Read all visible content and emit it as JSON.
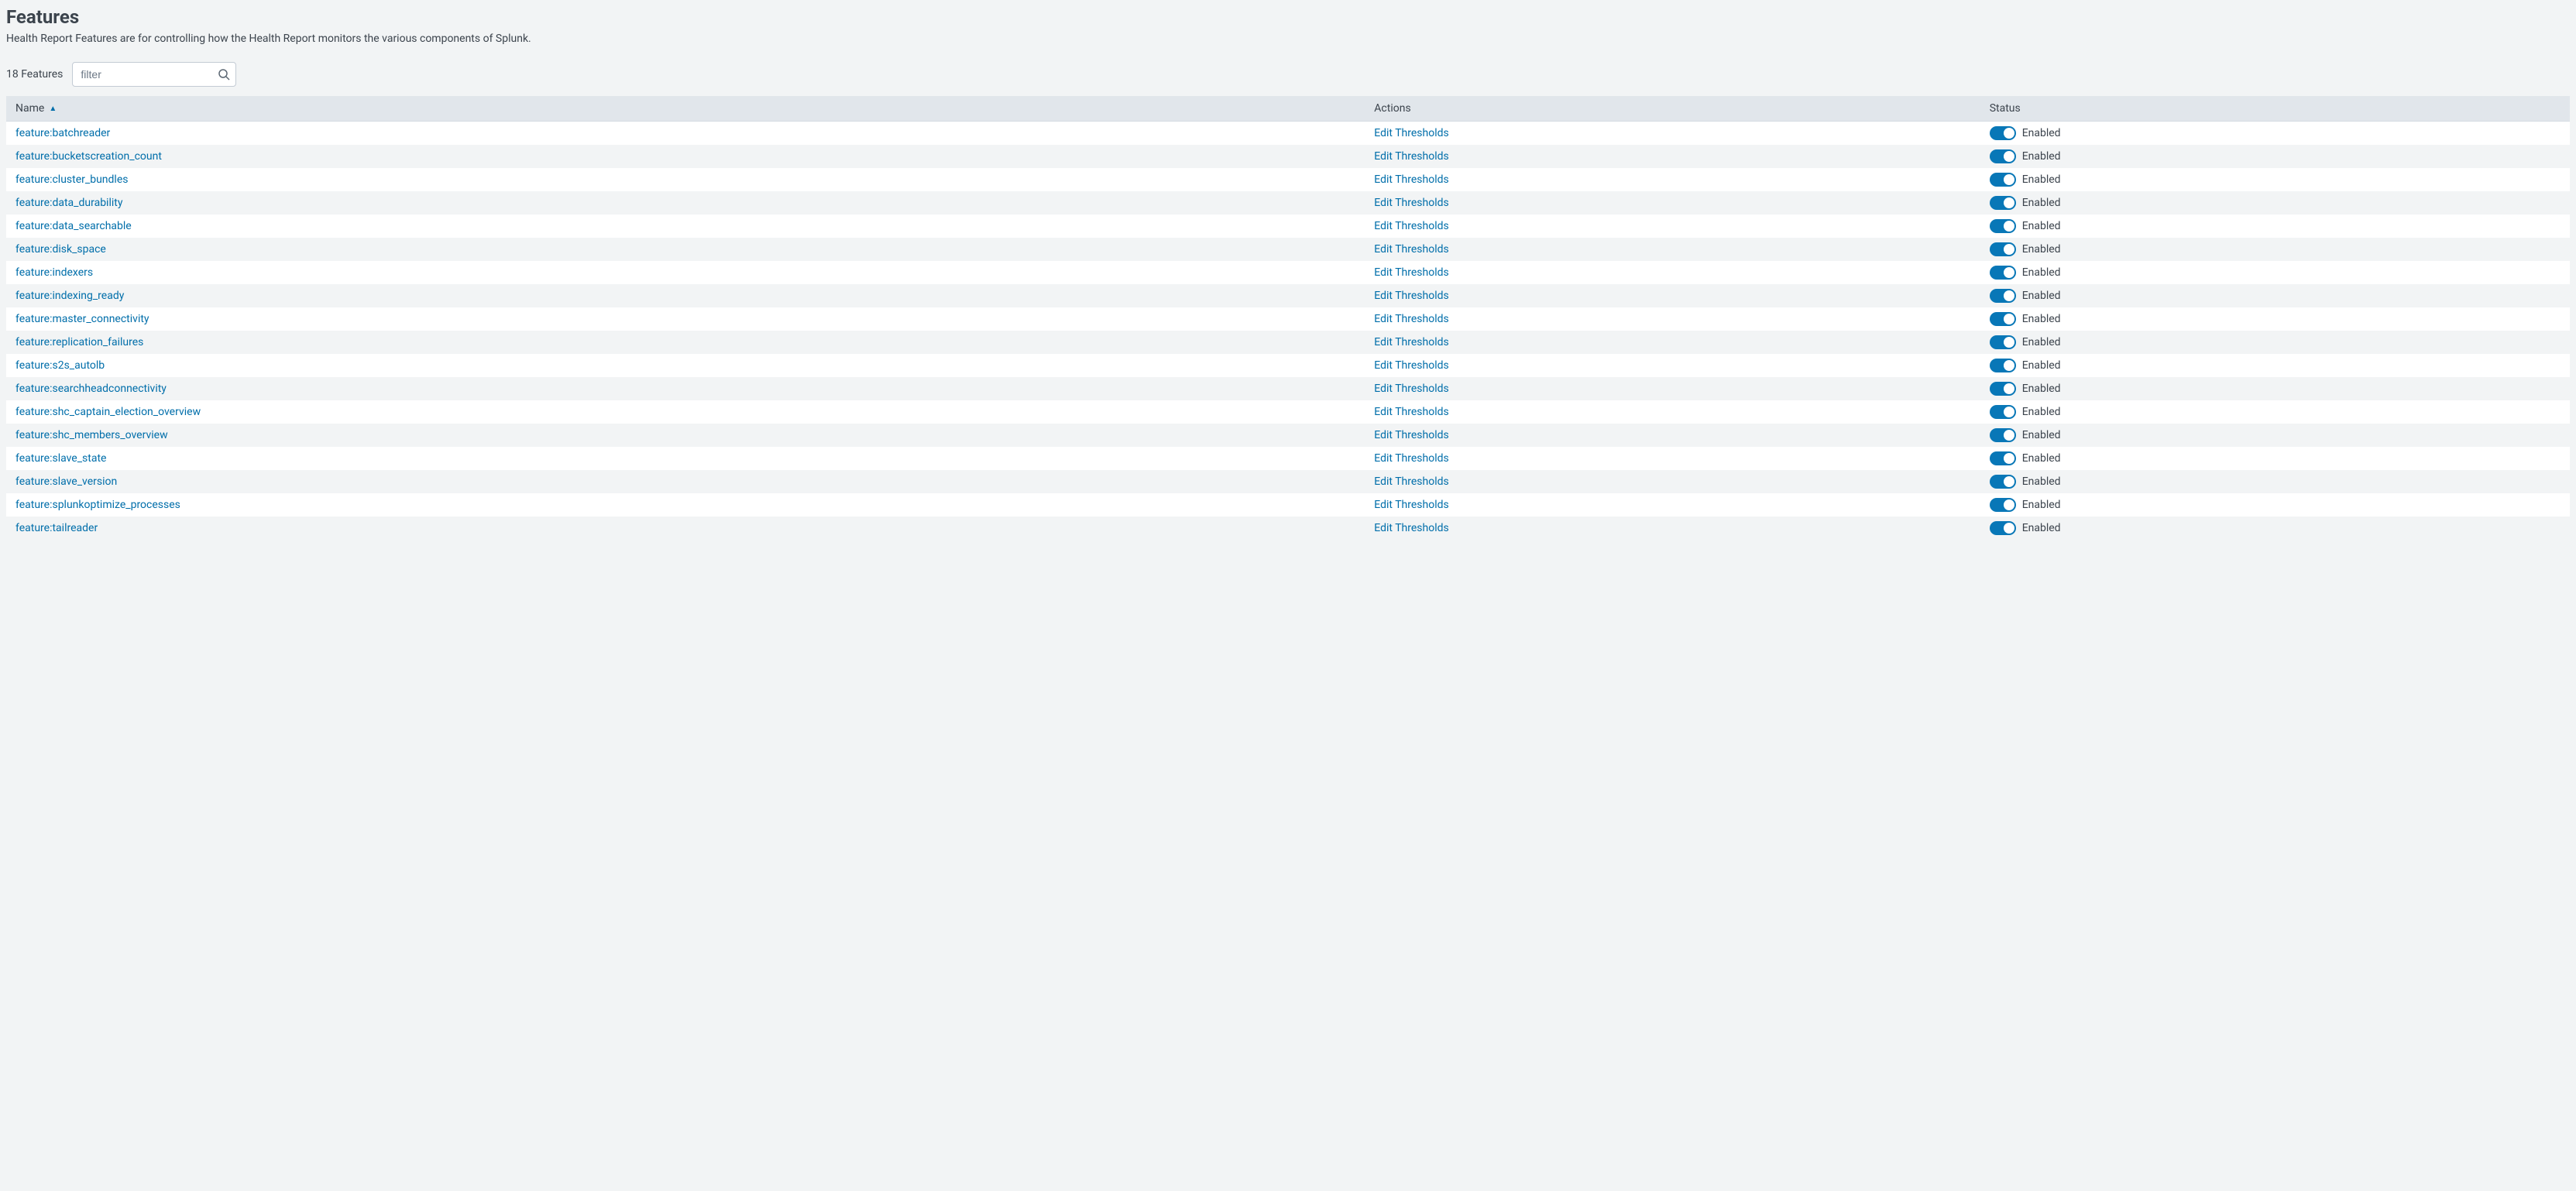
{
  "header": {
    "title": "Features",
    "description": "Health Report Features are for controlling how the Health Report monitors the various components of Splunk."
  },
  "controls": {
    "count_label": "18 Features",
    "filter_placeholder": "filter"
  },
  "table": {
    "columns": {
      "name": "Name",
      "actions": "Actions",
      "status": "Status"
    },
    "action_label": "Edit Thresholds",
    "status_label": "Enabled",
    "rows": [
      {
        "name": "feature:batchreader"
      },
      {
        "name": "feature:bucketscreation_count"
      },
      {
        "name": "feature:cluster_bundles"
      },
      {
        "name": "feature:data_durability"
      },
      {
        "name": "feature:data_searchable"
      },
      {
        "name": "feature:disk_space"
      },
      {
        "name": "feature:indexers"
      },
      {
        "name": "feature:indexing_ready"
      },
      {
        "name": "feature:master_connectivity"
      },
      {
        "name": "feature:replication_failures"
      },
      {
        "name": "feature:s2s_autolb"
      },
      {
        "name": "feature:searchheadconnectivity"
      },
      {
        "name": "feature:shc_captain_election_overview"
      },
      {
        "name": "feature:shc_members_overview"
      },
      {
        "name": "feature:slave_state"
      },
      {
        "name": "feature:slave_version"
      },
      {
        "name": "feature:splunkoptimize_processes"
      },
      {
        "name": "feature:tailreader"
      }
    ]
  }
}
